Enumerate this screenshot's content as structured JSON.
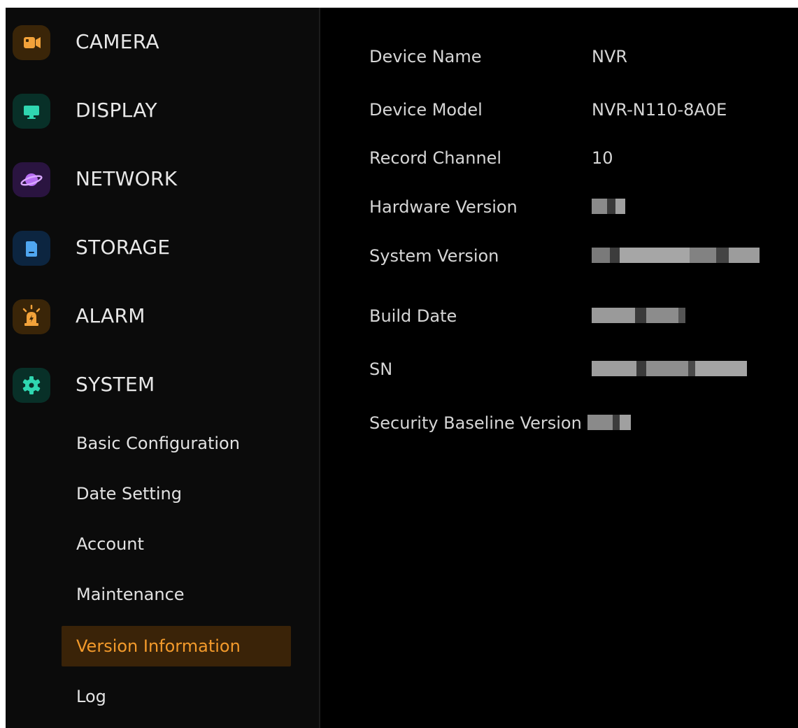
{
  "sidebar": {
    "menu": [
      {
        "label": "CAMERA",
        "icon": "camera-icon",
        "icon_bg": "#3a2508",
        "icon_color": "#f2a23a"
      },
      {
        "label": "DISPLAY",
        "icon": "monitor-icon",
        "icon_bg": "#083028",
        "icon_color": "#2fd6b0"
      },
      {
        "label": "NETWORK",
        "icon": "globe-icon",
        "icon_bg": "#2a1440",
        "icon_color": "#b66cf2"
      },
      {
        "label": "STORAGE",
        "icon": "sd-card-icon",
        "icon_bg": "#0c2540",
        "icon_color": "#4fa6f0"
      },
      {
        "label": "ALARM",
        "icon": "alarm-light-icon",
        "icon_bg": "#3a2508",
        "icon_color": "#f2a23a"
      },
      {
        "label": "SYSTEM",
        "icon": "gear-icon",
        "icon_bg": "#083028",
        "icon_color": "#2fd6b0"
      }
    ],
    "system_submenu": [
      {
        "label": "Basic Configuration"
      },
      {
        "label": "Date Setting"
      },
      {
        "label": "Account"
      },
      {
        "label": "Maintenance"
      },
      {
        "label": "Version Information",
        "active": true
      },
      {
        "label": "Log"
      }
    ]
  },
  "version_info": {
    "rows": [
      {
        "label": "Device Name",
        "value": "NVR"
      },
      {
        "label": "Device Model",
        "value": "NVR-N110-8A0E"
      },
      {
        "label": "Record Channel",
        "value": "10"
      },
      {
        "label": "Hardware Version",
        "value": ""
      },
      {
        "label": "System Version",
        "value": ""
      },
      {
        "label": "Build Date",
        "value": ""
      },
      {
        "label": "SN",
        "value": ""
      },
      {
        "label": "Security Baseline Version",
        "value": ""
      }
    ]
  },
  "colors": {
    "accent": "#f39a2b",
    "active_bg": "#3a2308",
    "background": "#000000",
    "sidebar_bg": "#0b0b0b",
    "text": "#e2e2e2"
  }
}
